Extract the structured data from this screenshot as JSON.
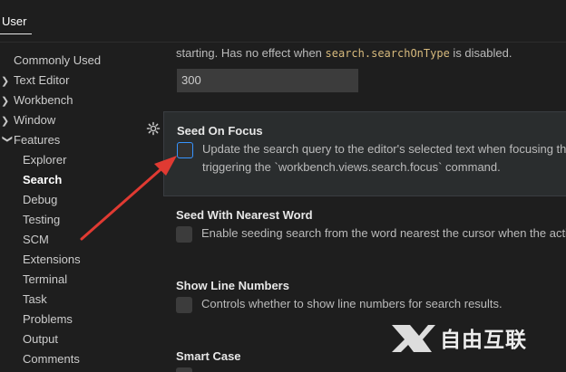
{
  "tab": {
    "label": "User"
  },
  "sidebar": {
    "items": [
      {
        "label": "Commonly Used",
        "chevron": ""
      },
      {
        "label": "Text Editor",
        "chevron": "right"
      },
      {
        "label": "Workbench",
        "chevron": "right"
      },
      {
        "label": "Window",
        "chevron": "right"
      },
      {
        "label": "Features",
        "chevron": "down"
      },
      {
        "label": "Explorer"
      },
      {
        "label": "Search",
        "active": true
      },
      {
        "label": "Debug"
      },
      {
        "label": "Testing"
      },
      {
        "label": "SCM"
      },
      {
        "label": "Extensions"
      },
      {
        "label": "Terminal"
      },
      {
        "label": "Task"
      },
      {
        "label": "Problems"
      },
      {
        "label": "Output"
      },
      {
        "label": "Comments"
      }
    ]
  },
  "top_setting": {
    "desc_pre": "starting. Has no effect when ",
    "desc_code": "search.searchOnType",
    "desc_post": " is disabled.",
    "value": "300"
  },
  "settings": [
    {
      "title": "Seed On Focus",
      "desc_line1": "Update the search query to the editor's selected text when focusing the",
      "desc_line2": "triggering the `workbench.views.search.focus` command.",
      "checked": false
    },
    {
      "title": "Seed With Nearest Word",
      "desc_line1": "Enable seeding search from the word nearest the cursor when the active",
      "checked": false
    },
    {
      "title": "Show Line Numbers",
      "desc_line1": "Controls whether to show line numbers for search results.",
      "checked": false
    },
    {
      "title": "Smart Case",
      "checked": false
    }
  ],
  "watermark": {
    "text": "自由互联"
  },
  "colors": {
    "accent": "#3794ff",
    "arrow": "#e03a32"
  }
}
